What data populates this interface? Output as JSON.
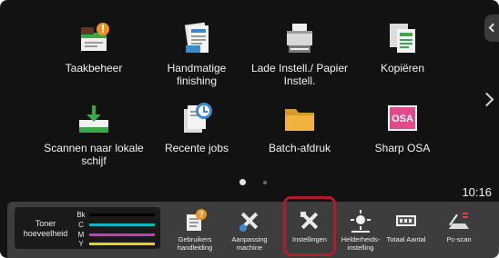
{
  "home_tiles": [
    {
      "icon": "job-status-icon",
      "label": "Taakbeheer"
    },
    {
      "icon": "manual-finishing-icon",
      "label": "Handmatige finishing"
    },
    {
      "icon": "tray-settings-icon",
      "label": "Lade Instell./ Papier Instell."
    },
    {
      "icon": "copy-icon",
      "label": "Kopiëren"
    },
    {
      "icon": "scan-to-local-drive-icon",
      "label": "Scannen naar lokale schijf"
    },
    {
      "icon": "recent-jobs-icon",
      "label": "Recente jobs"
    },
    {
      "icon": "batch-print-icon",
      "label": "Batch-afdruk"
    },
    {
      "icon": "sharp-osa-icon",
      "label": "Sharp OSA"
    }
  ],
  "osa_logo_text": "OSA",
  "pager": {
    "current_page": 1,
    "total_pages": 2
  },
  "clock": "10:16",
  "toner": {
    "title": "Toner hoeveelheid",
    "colors": [
      {
        "letter": "Bk",
        "color": "#000000",
        "level": 1.0
      },
      {
        "letter": "C",
        "color": "#14b4c8",
        "level": 1.0
      },
      {
        "letter": "M",
        "color": "#c040c0",
        "level": 1.0
      },
      {
        "letter": "Y",
        "color": "#e8d020",
        "level": 1.0
      }
    ]
  },
  "dock": [
    {
      "icon": "user-manual-icon",
      "label": "Gebruikers handleiding"
    },
    {
      "icon": "machine-customize-icon",
      "label": "Aanpassing machine"
    },
    {
      "icon": "settings-tools-icon",
      "label": "Instellingen",
      "selected": true
    },
    {
      "icon": "brightness-icon",
      "label": "Helderheids- instelling"
    },
    {
      "icon": "total-count-icon",
      "label": "Totaal Aantal"
    },
    {
      "icon": "pc-scan-icon",
      "label": "Pc-scan"
    }
  ],
  "colors": {
    "screen_background": "#121212",
    "dock_background": "#3d3d3d",
    "highlight": "#b01c2e",
    "icon_green": "#3aa84a",
    "icon_orange": "#f09020"
  }
}
